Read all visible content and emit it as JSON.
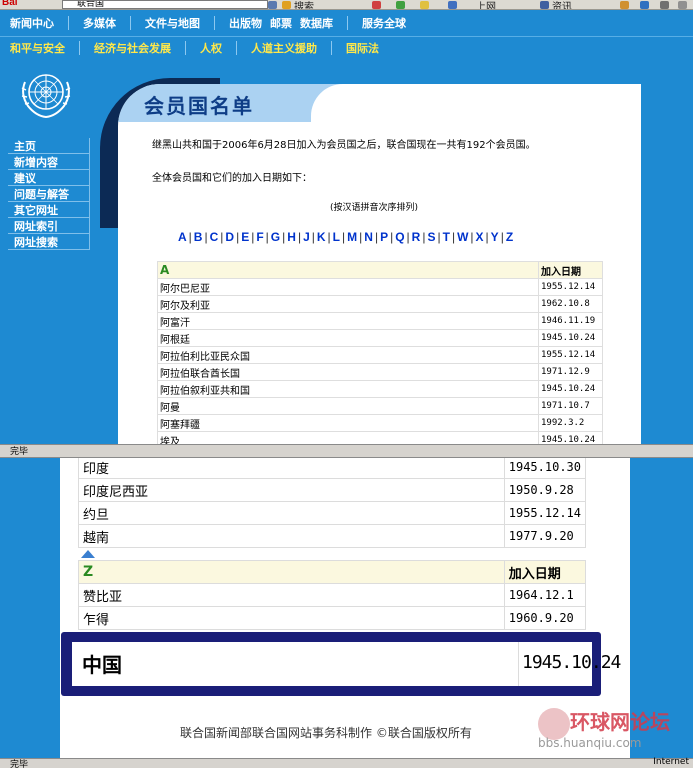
{
  "toolbar": {
    "brand": "Bai",
    "address": "联合国",
    "search_btn": "搜索",
    "item2": "上网",
    "item3": "资讯"
  },
  "nav_primary": [
    "新闻中心",
    "多媒体",
    "文件与地图",
    "出版物",
    "邮票",
    "数据库",
    "服务全球"
  ],
  "nav_secondary": [
    "和平与安全",
    "经济与社会发展",
    "人权",
    "人道主义援助",
    "国际法"
  ],
  "sidebar": {
    "items": [
      "主页",
      "新增内容",
      "建议",
      "问题与解答",
      "其它网址",
      "网址索引",
      "网址搜索"
    ]
  },
  "page": {
    "title": "会员国名单",
    "intro": "继黑山共和国于2006年6月28日加入为会员国之后，联合国现在一共有192个会员国。",
    "intro2": "全体会员国和它们的加入日期如下：",
    "sort_note": "(按汉语拼音次序排列)",
    "alphabet": [
      "A",
      "B",
      "C",
      "D",
      "E",
      "F",
      "G",
      "H",
      "J",
      "K",
      "L",
      "M",
      "N",
      "P",
      "Q",
      "R",
      "S",
      "T",
      "W",
      "X",
      "Y",
      "Z"
    ]
  },
  "table_a": {
    "letter": "A",
    "date_header": "加入日期",
    "rows": [
      {
        "name": "阿尔巴尼亚",
        "date": "1955.12.14"
      },
      {
        "name": "阿尔及利亚",
        "date": "1962.10.8"
      },
      {
        "name": "阿富汗",
        "date": "1946.11.19"
      },
      {
        "name": "阿根廷",
        "date": "1945.10.24"
      },
      {
        "name": "阿拉伯利比亚民众国",
        "date": "1955.12.14"
      },
      {
        "name": "阿拉伯联合酋长国",
        "date": "1971.12.9"
      },
      {
        "name": "阿拉伯叙利亚共和国",
        "date": "1945.10.24"
      },
      {
        "name": "阿曼",
        "date": "1971.10.7"
      },
      {
        "name": "阿塞拜疆",
        "date": "1992.3.2"
      },
      {
        "name": "埃及",
        "date": "1945.10.24"
      }
    ]
  },
  "status_top": "完毕",
  "table_y": {
    "rows": [
      {
        "name": "印度",
        "date": "1945.10.30"
      },
      {
        "name": "印度尼西亚",
        "date": "1950.9.28"
      },
      {
        "name": "约旦",
        "date": "1955.12.14"
      },
      {
        "name": "越南",
        "date": "1977.9.20"
      }
    ]
  },
  "table_z": {
    "letter": "Z",
    "date_header": "加入日期",
    "rows": [
      {
        "name": "赞比亚",
        "date": "1964.12.1"
      },
      {
        "name": "乍得",
        "date": "1960.9.20"
      }
    ]
  },
  "highlight": {
    "name": "中国",
    "date": "1945.10.24"
  },
  "footer": "联合国新闻部联合国网站事务科制作 ©联合国版权所有",
  "watermark": {
    "title": "环球网论坛",
    "url": "bbs.huanqiu.com"
  },
  "status_bottom": {
    "left": "完毕",
    "right": "Internet"
  },
  "colors": {
    "nav_blue": "#1e8ad2",
    "title_navy": "#0e3d86",
    "highlight_frame": "#1a1e78",
    "letter_green": "#2a8a22"
  }
}
